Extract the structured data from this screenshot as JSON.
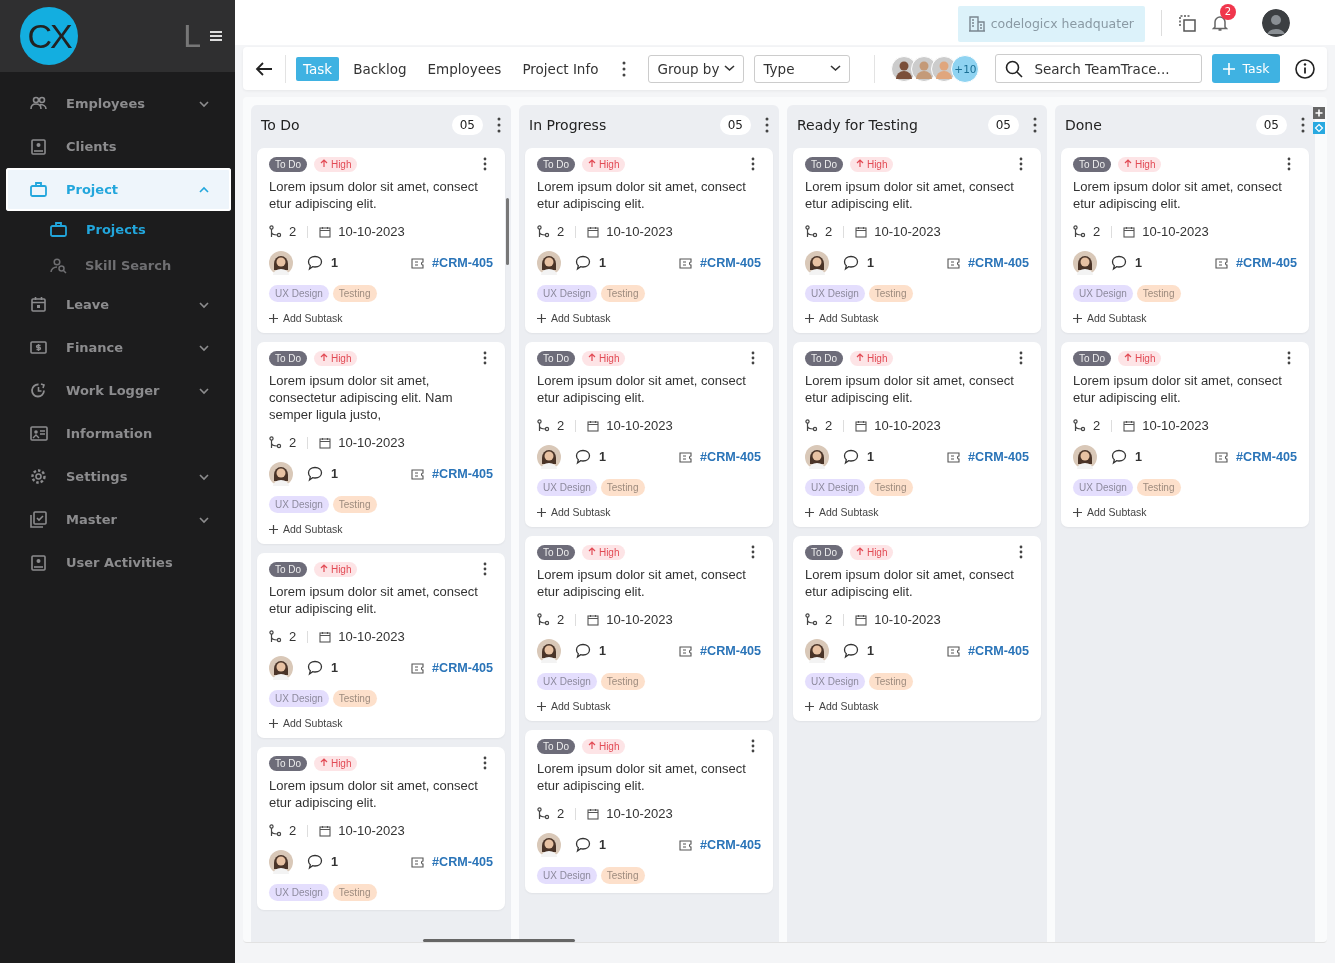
{
  "sidebar": {
    "logo": "CX",
    "logo_mark": "L",
    "items": [
      {
        "label": "Employees",
        "selected": false,
        "expanded": false
      },
      {
        "label": "Clients",
        "selected": false
      },
      {
        "label": "Project",
        "selected": true,
        "expanded": true,
        "children": [
          {
            "label": "Projects",
            "selected": true
          },
          {
            "label": "Skill Search",
            "selected": false
          }
        ]
      },
      {
        "label": "Leave",
        "selected": false,
        "expanded": false
      },
      {
        "label": "Finance",
        "selected": false,
        "expanded": false
      },
      {
        "label": "Work Logger",
        "selected": false,
        "expanded": false
      },
      {
        "label": "Information",
        "selected": false
      },
      {
        "label": "Settings",
        "selected": false,
        "expanded": false
      },
      {
        "label": "Master",
        "selected": false,
        "expanded": false
      },
      {
        "label": "User Activities",
        "selected": false
      }
    ]
  },
  "header": {
    "workspace": "codelogicx headquater",
    "notification_count": "2"
  },
  "toolbar": {
    "tabs": [
      {
        "label": "Task",
        "selected": true
      },
      {
        "label": "Backlog",
        "selected": false
      },
      {
        "label": "Employees",
        "selected": false
      },
      {
        "label": "Project Info",
        "selected": false
      }
    ],
    "group_by": "Group by",
    "type": "Type",
    "members_more": "+10",
    "search_placeholder": "Search TeamTrace...",
    "add_button": "Task"
  },
  "columns": [
    {
      "title": "To Do",
      "count": "05",
      "cards": [
        {
          "status": "To Do",
          "priority": "High",
          "title": "Lorem ipsum dolor sit amet, consect etur adipiscing elit.",
          "subtasks": "2",
          "date": "10-10-2023",
          "comments": "1",
          "ticket": "#CRM-405",
          "tags": [
            {
              "label": "UX Design",
              "color": "#e4defd"
            },
            {
              "label": "Testing",
              "color": "#fde0cb"
            }
          ],
          "add_subtask": "Add Subtask"
        },
        {
          "status": "To Do",
          "priority": "High",
          "title": "Lorem ipsum dolor sit amet, consectetur adipiscing elit. Nam semper ligula justo,",
          "subtasks": "2",
          "date": "10-10-2023",
          "comments": "1",
          "ticket": "#CRM-405",
          "tags": [
            {
              "label": "UX Design",
              "color": "#e4defd"
            },
            {
              "label": "Testing",
              "color": "#fde0cb"
            }
          ],
          "add_subtask": "Add Subtask"
        },
        {
          "status": "To Do",
          "priority": "High",
          "title": "Lorem ipsum dolor sit amet, consect etur adipiscing elit.",
          "subtasks": "2",
          "date": "10-10-2023",
          "comments": "1",
          "ticket": "#CRM-405",
          "tags": [
            {
              "label": "UX Design",
              "color": "#e4defd"
            },
            {
              "label": "Testing",
              "color": "#fde0cb"
            }
          ],
          "add_subtask": "Add Subtask"
        },
        {
          "status": "To Do",
          "priority": "High",
          "title": "Lorem ipsum dolor sit amet, consect etur adipiscing elit.",
          "subtasks": "2",
          "date": "10-10-2023",
          "comments": "1",
          "ticket": "#CRM-405",
          "tags": [
            {
              "label": "UX Design",
              "color": "#e4defd"
            },
            {
              "label": "Testing",
              "color": "#fde0cb"
            }
          ]
        }
      ]
    },
    {
      "title": "In Progress",
      "count": "05",
      "cards": [
        {
          "status": "To Do",
          "priority": "High",
          "title": "Lorem ipsum dolor sit amet, consect etur adipiscing elit.",
          "subtasks": "2",
          "date": "10-10-2023",
          "comments": "1",
          "ticket": "#CRM-405",
          "tags": [
            {
              "label": "UX Design",
              "color": "#e4defd"
            },
            {
              "label": "Testing",
              "color": "#fde0cb"
            }
          ],
          "add_subtask": "Add Subtask"
        },
        {
          "status": "To Do",
          "priority": "High",
          "title": "Lorem ipsum dolor sit amet, consect etur adipiscing elit.",
          "subtasks": "2",
          "date": "10-10-2023",
          "comments": "1",
          "ticket": "#CRM-405",
          "tags": [
            {
              "label": "UX Design",
              "color": "#e4defd"
            },
            {
              "label": "Testing",
              "color": "#fde0cb"
            }
          ],
          "add_subtask": "Add Subtask"
        },
        {
          "status": "To Do",
          "priority": "High",
          "title": "Lorem ipsum dolor sit amet, consect etur adipiscing elit.",
          "subtasks": "2",
          "date": "10-10-2023",
          "comments": "1",
          "ticket": "#CRM-405",
          "tags": [
            {
              "label": "UX Design",
              "color": "#e4defd"
            },
            {
              "label": "Testing",
              "color": "#fde0cb"
            }
          ],
          "add_subtask": "Add Subtask"
        },
        {
          "status": "To Do",
          "priority": "High",
          "title": "Lorem ipsum dolor sit amet, consect etur adipiscing elit.",
          "subtasks": "2",
          "date": "10-10-2023",
          "comments": "1",
          "ticket": "#CRM-405",
          "tags": [
            {
              "label": "UX Design",
              "color": "#e4defd"
            },
            {
              "label": "Testing",
              "color": "#fde0cb"
            }
          ]
        }
      ]
    },
    {
      "title": "Ready for Testing",
      "count": "05",
      "cards": [
        {
          "status": "To Do",
          "priority": "High",
          "title": "Lorem ipsum dolor sit amet, consect etur adipiscing elit.",
          "subtasks": "2",
          "date": "10-10-2023",
          "comments": "1",
          "ticket": "#CRM-405",
          "tags": [
            {
              "label": "UX Design",
              "color": "#e4defd"
            },
            {
              "label": "Testing",
              "color": "#fde0cb"
            }
          ],
          "add_subtask": "Add Subtask"
        },
        {
          "status": "To Do",
          "priority": "High",
          "title": "Lorem ipsum dolor sit amet, consect etur adipiscing elit.",
          "subtasks": "2",
          "date": "10-10-2023",
          "comments": "1",
          "ticket": "#CRM-405",
          "tags": [
            {
              "label": "UX Design",
              "color": "#e4defd"
            },
            {
              "label": "Testing",
              "color": "#fde0cb"
            }
          ],
          "add_subtask": "Add Subtask"
        },
        {
          "status": "To Do",
          "priority": "High",
          "title": "Lorem ipsum dolor sit amet, consect etur adipiscing elit.",
          "subtasks": "2",
          "date": "10-10-2023",
          "comments": "1",
          "ticket": "#CRM-405",
          "tags": [
            {
              "label": "UX Design",
              "color": "#e4defd"
            },
            {
              "label": "Testing",
              "color": "#fde0cb"
            }
          ],
          "add_subtask": "Add Subtask"
        }
      ]
    },
    {
      "title": "Done",
      "count": "05",
      "cards": [
        {
          "status": "To Do",
          "priority": "High",
          "title": "Lorem ipsum dolor sit amet, consect etur adipiscing elit.",
          "subtasks": "2",
          "date": "10-10-2023",
          "comments": "1",
          "ticket": "#CRM-405",
          "tags": [
            {
              "label": "UX Design",
              "color": "#e4defd"
            },
            {
              "label": "Testing",
              "color": "#fde0cb"
            }
          ],
          "add_subtask": "Add Subtask"
        },
        {
          "status": "To Do",
          "priority": "High",
          "title": "Lorem ipsum dolor sit amet, consect etur adipiscing elit.",
          "subtasks": "2",
          "date": "10-10-2023",
          "comments": "1",
          "ticket": "#CRM-405",
          "tags": [
            {
              "label": "UX Design",
              "color": "#e4defd"
            },
            {
              "label": "Testing",
              "color": "#fde0cb"
            }
          ],
          "add_subtask": "Add Subtask"
        }
      ]
    }
  ]
}
